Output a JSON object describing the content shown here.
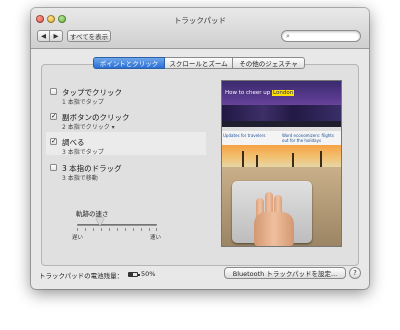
{
  "window": {
    "title": "トラックパッド",
    "nav_back": "◀",
    "nav_forward": "▶",
    "show_all": "すべてを表示",
    "search_placeholder": ""
  },
  "tabs": [
    {
      "label": "ポイントとクリック",
      "active": true
    },
    {
      "label": "スクロールとズーム",
      "active": false
    },
    {
      "label": "その他のジェスチャ",
      "active": false
    }
  ],
  "options": [
    {
      "label": "タップでクリック",
      "sub": "1 本指でタップ",
      "checked": false
    },
    {
      "label": "副ボタンのクリック",
      "sub": "2 本指でクリック ▾",
      "checked": true
    },
    {
      "label": "調べる",
      "sub": "3 本指でタップ",
      "checked": true
    },
    {
      "label": "3 本指のドラッグ",
      "sub": "3 本指で移動",
      "checked": false
    }
  ],
  "tracking_speed": {
    "label": "軌跡の速さ",
    "slow": "遅い",
    "fast": "速い",
    "value_fraction": 0.29
  },
  "preview": {
    "headline_prefix": "How to cheer up",
    "headline_highlight": "London",
    "col1_title": "Updates for travelers",
    "col2_title": "Word economizers: flights out for the holidays"
  },
  "footer": {
    "battery_label": "トラックパッドの電池残量：",
    "battery_percent": "50%",
    "battery_level": 0.5,
    "bluetooth_button": "Bluetooth トラックパッドを設定...",
    "help": "?"
  },
  "icons": {
    "close": "close-icon",
    "minimize": "minimize-icon",
    "zoom": "zoom-icon",
    "search": "search-icon",
    "battery": "battery-icon",
    "help": "help-icon"
  },
  "colors": {
    "tab_active": "#2a6fd6",
    "window_bg": "#e8e8e8"
  }
}
